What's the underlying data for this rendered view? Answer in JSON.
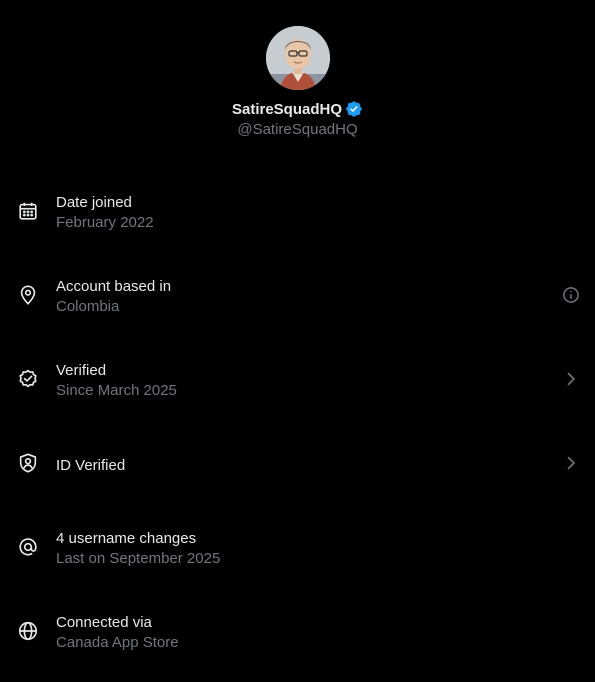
{
  "profile": {
    "display_name": "SatireSquadHQ",
    "handle": "@SatireSquadHQ",
    "verified_badge_icon": "verified-checkmark-icon",
    "verified_badge_color": "#1d9bf0"
  },
  "rows": [
    {
      "icon": "calendar-icon",
      "title": "Date joined",
      "subtitle": "February 2022",
      "trailing": ""
    },
    {
      "icon": "location-pin-icon",
      "title": "Account based in",
      "subtitle": "Colombia",
      "trailing": "info-icon"
    },
    {
      "icon": "verified-badge-icon",
      "title": "Verified",
      "subtitle": "Since March 2025",
      "trailing": "chevron-right-icon"
    },
    {
      "icon": "shield-user-icon",
      "title": "ID Verified",
      "subtitle": "",
      "trailing": "chevron-right-icon"
    },
    {
      "icon": "at-sign-icon",
      "title": "4 username changes",
      "subtitle": "Last on September 2025",
      "trailing": ""
    },
    {
      "icon": "globe-icon",
      "title": "Connected via",
      "subtitle": "Canada App Store",
      "trailing": ""
    }
  ],
  "colors": {
    "background": "#000000",
    "primary_text": "#e7e9ea",
    "secondary_text": "#71767b",
    "accent": "#1d9bf0"
  }
}
